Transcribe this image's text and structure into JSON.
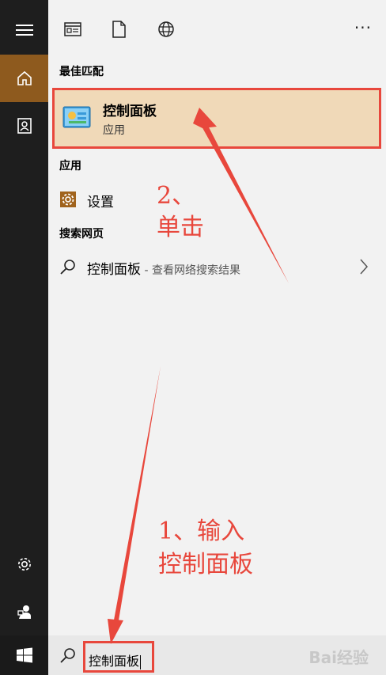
{
  "rail": {
    "menu_icon": "hamburger-icon",
    "home_icon": "home-icon",
    "documents_icon": "contacts-icon",
    "settings_icon": "gear-icon",
    "user_icon": "user-icon",
    "start_icon": "windows-logo-icon",
    "accent": "#8e5a1e"
  },
  "topbar": {
    "icons": [
      "apps-icon",
      "documents-icon",
      "web-icon"
    ],
    "more_label": "···"
  },
  "results": {
    "best_match_heading": "最佳匹配",
    "best_match": {
      "title": "控制面板",
      "subtitle": "应用"
    },
    "apps_heading": "应用",
    "apps": [
      {
        "label": "设置"
      }
    ],
    "web_heading": "搜索网页",
    "web": [
      {
        "label": "控制面板",
        "hint": " - 查看网络搜索结果"
      }
    ]
  },
  "search": {
    "value": "控制面板"
  },
  "annotations": {
    "step2_line1": "2、",
    "step2_line2": "单击",
    "step1_line1": "1、输入",
    "step1_line2": "控制面板",
    "color": "#e8473c"
  },
  "watermark": "Bai经验"
}
